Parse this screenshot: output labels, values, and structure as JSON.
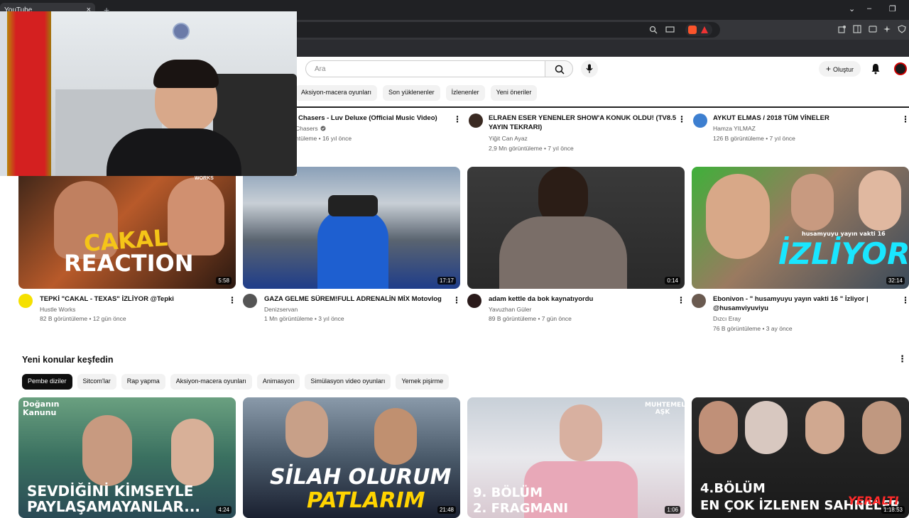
{
  "browser": {
    "tab_title": "YouTube",
    "tab_close": "×",
    "new_tab": "+",
    "win_min": "–",
    "win_restore": "❐",
    "win_chevron": "⌄"
  },
  "header": {
    "search_placeholder": "Ara",
    "create_label": "Oluştur"
  },
  "top_chips": [
    "Aksiyon-macera oyunları",
    "Son yüklenenler",
    "İzlenenler",
    "Yeni öneriler"
  ],
  "row1": [
    {
      "title": "Chasers - Luv Deluxe (Official Music Video)",
      "channel": "Chasers",
      "stats": "ntüleme • 16 yıl önce"
    },
    {
      "title_l1": "ELRAEN ESER YENENLER SHOW'A KONUK OLDU! (TV8.5",
      "title_l2": "YAYIN TEKRARI)",
      "channel": "Yiğit Can Ayaz",
      "stats": "2,9 Mn görüntüleme • 7 yıl önce"
    },
    {
      "title": "AYKUT ELMAS / 2018 TÜM VİNELER",
      "channel": "Hamza YILMAZ",
      "stats": "126 B görüntüleme • 7 yıl önce"
    }
  ],
  "row2": [
    {
      "title": "TEPKİ \"CAKAL - TEXAS\" İZLİYOR @Tepki",
      "channel": "Hustle Works",
      "stats": "82 B görüntüleme • 12 gün önce",
      "duration": "5:58",
      "thumb_text_1": "CAKAL",
      "thumb_text_2": "REACTION",
      "badge": "HUSTLE WORKS"
    },
    {
      "title": "GAZA GELME SÜREM!FULL ADRENALİN MİX Motovlog",
      "channel": "Denizservan",
      "stats": "1 Mn görüntüleme • 3 yıl önce",
      "duration": "17:17"
    },
    {
      "title": "adam kettle da bok kaynatıyordu",
      "channel": "Yavuzhan Güler",
      "stats": "89 B görüntüleme • 7 gün önce",
      "duration": "0:14"
    },
    {
      "title_l1": "Ebonivon - \" husamyuyu yayın vakti 16 \" İzliyor |",
      "title_l2": "@husamviyuviyu",
      "channel": "Dızcı Eray",
      "stats": "76 B görüntüleme • 3 ay önce",
      "duration": "32:14",
      "thumb_small": "husamyuyu yayın vakti 16",
      "thumb_big": "İZLİYOR!"
    }
  ],
  "section": {
    "title": "Yeni konular keşfedin",
    "chips": [
      "Pembe diziler",
      "Sitcom'lar",
      "Rap yapma",
      "Aksiyon-macera oyunları",
      "Animasyon",
      "Simülasyon video oyunları",
      "Yemek pişirme"
    ]
  },
  "row3": [
    {
      "logo": "Doğanın Kanunu",
      "caption_1": "SEVDİĞİNİ KİMSEYLE",
      "caption_2": "PAYLAŞAMAYANLAR...",
      "duration": "4:24"
    },
    {
      "caption_1": "SİLAH OLURUM",
      "caption_2": "PATLARIM",
      "duration": "21:48"
    },
    {
      "logo": "MUHTEMEL AŞK",
      "caption_1": "9. BÖLÜM",
      "caption_2": "2. FRAGMANI",
      "duration": "1:06"
    },
    {
      "caption_1": "4.BÖLÜM",
      "caption_2": "EN ÇOK İZLENEN SAHNELER",
      "badge": "YERALTI",
      "duration": "1:18:53"
    }
  ],
  "colors": {
    "yt_red": "#ff0000",
    "chrome_dark": "#202124",
    "chip_bg": "#f2f2f2"
  }
}
